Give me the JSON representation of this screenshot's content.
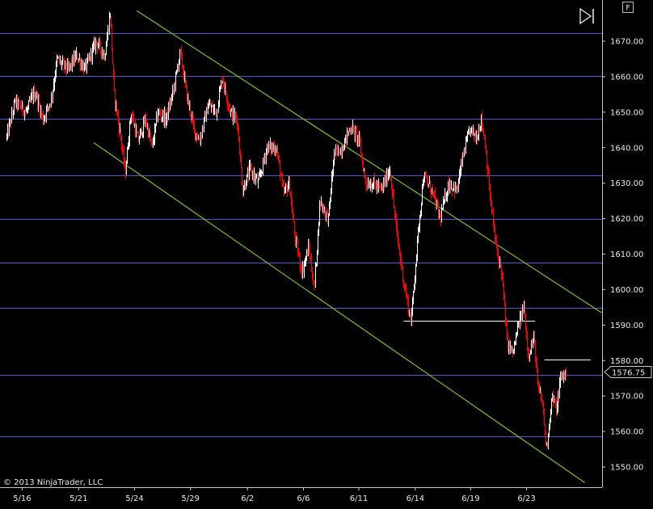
{
  "copyright": "© 2013 NinjaTrader, LLC",
  "buttons": {
    "scroll_end": "▷|",
    "format": "F"
  },
  "colors": {
    "background": "#000000",
    "up_bar": "#ffffff",
    "down_bar": "#ff0000",
    "horizontal_line": "#4a56d6",
    "channel_line": "#7fc31c",
    "level_line": "#ffffff",
    "axis": "#c8c8c8",
    "text": "#e8e8e8"
  },
  "chart_data": {
    "type": "line",
    "chart_style": "ohlc-bars",
    "x_tick_labels": [
      "5/16",
      "5/21",
      "5/24",
      "5/29",
      "6/2",
      "6/6",
      "6/11",
      "6/14",
      "6/19",
      "6/23"
    ],
    "y_ticks": [
      1550,
      1560,
      1570,
      1580,
      1590,
      1600,
      1610,
      1620,
      1630,
      1640,
      1650,
      1660,
      1670
    ],
    "y_tick_labels": [
      "1550.00",
      "1560.00",
      "1570.00",
      "1580.00",
      "1590.00",
      "1600.00",
      "1610.00",
      "1620.00",
      "1630.00",
      "1640.00",
      "1650.00",
      "1660.00",
      "1670.00"
    ],
    "ylim": [
      1546,
      1675
    ],
    "x_domain": [
      0,
      100
    ],
    "x_tick_positions": [
      2.8,
      12.9,
      22.9,
      32.9,
      43.1,
      53.1,
      63.0,
      73.1,
      83.0,
      93.0
    ],
    "current_price": 1576.75,
    "current_price_label": "1576.75",
    "horizontal_lines": [
      1672.2,
      1660.3,
      1648.2,
      1632.3,
      1620.0,
      1607.5,
      1594.8,
      1576.0,
      1558.7
    ],
    "level_lines": [
      {
        "price": 1591.2,
        "x_start": 71.0,
        "x_end": 94.5
      },
      {
        "price": 1580.2,
        "x_start": 96.2,
        "x_end": 104.5
      }
    ],
    "trend_lines": [
      {
        "x1": 23.3,
        "y1": 1678.6,
        "x2": 106.4,
        "y2": 1593.5
      },
      {
        "x1": 15.6,
        "y1": 1641.4,
        "x2": 103.4,
        "y2": 1545.6
      }
    ],
    "price_path": [
      [
        0.0,
        1643
      ],
      [
        1.5,
        1653
      ],
      [
        3.5,
        1650
      ],
      [
        5.0,
        1656
      ],
      [
        6.5,
        1648
      ],
      [
        8.0,
        1654
      ],
      [
        9.0,
        1665
      ],
      [
        11.0,
        1662
      ],
      [
        12.5,
        1666
      ],
      [
        14.0,
        1662
      ],
      [
        15.0,
        1666
      ],
      [
        16.0,
        1670
      ],
      [
        17.5,
        1666
      ],
      [
        18.5,
        1678
      ],
      [
        19.2,
        1655
      ],
      [
        20.2,
        1645
      ],
      [
        21.2,
        1633
      ],
      [
        22.2,
        1650
      ],
      [
        23.5,
        1642
      ],
      [
        24.8,
        1648
      ],
      [
        26.0,
        1640
      ],
      [
        27.0,
        1650
      ],
      [
        28.5,
        1648
      ],
      [
        29.8,
        1656
      ],
      [
        31.0,
        1667
      ],
      [
        32.2,
        1655
      ],
      [
        33.5,
        1645
      ],
      [
        34.5,
        1642
      ],
      [
        36.0,
        1652
      ],
      [
        37.5,
        1650
      ],
      [
        38.5,
        1660
      ],
      [
        40.0,
        1650
      ],
      [
        41.2,
        1648
      ],
      [
        42.2,
        1628
      ],
      [
        43.5,
        1634
      ],
      [
        45.0,
        1630
      ],
      [
        46.5,
        1640
      ],
      [
        48.2,
        1640
      ],
      [
        49.5,
        1627
      ],
      [
        50.5,
        1630
      ],
      [
        51.5,
        1615
      ],
      [
        52.8,
        1605
      ],
      [
        54.0,
        1612
      ],
      [
        55.0,
        1600
      ],
      [
        56.0,
        1625
      ],
      [
        57.5,
        1620
      ],
      [
        58.5,
        1638
      ],
      [
        60.0,
        1640
      ],
      [
        61.5,
        1646
      ],
      [
        63.0,
        1642
      ],
      [
        64.2,
        1630
      ],
      [
        65.5,
        1630
      ],
      [
        67.0,
        1628
      ],
      [
        68.5,
        1634
      ],
      [
        69.8,
        1615
      ],
      [
        71.0,
        1602
      ],
      [
        72.3,
        1591
      ],
      [
        73.5,
        1615
      ],
      [
        74.5,
        1632
      ],
      [
        76.0,
        1628
      ],
      [
        77.5,
        1620
      ],
      [
        79.0,
        1630
      ],
      [
        80.5,
        1628
      ],
      [
        81.5,
        1637
      ],
      [
        82.8,
        1645
      ],
      [
        84.0,
        1643
      ],
      [
        84.8,
        1648
      ],
      [
        85.5,
        1642
      ],
      [
        86.5,
        1625
      ],
      [
        87.5,
        1612
      ],
      [
        88.5,
        1605
      ],
      [
        89.5,
        1585
      ],
      [
        90.5,
        1582
      ],
      [
        91.5,
        1590
      ],
      [
        92.5,
        1595
      ],
      [
        93.2,
        1582
      ],
      [
        94.3,
        1586
      ],
      [
        95.0,
        1572
      ],
      [
        95.8,
        1568
      ],
      [
        96.5,
        1555
      ],
      [
        97.5,
        1570
      ],
      [
        98.3,
        1566
      ],
      [
        99.0,
        1575
      ],
      [
        100.0,
        1576.75
      ]
    ]
  }
}
